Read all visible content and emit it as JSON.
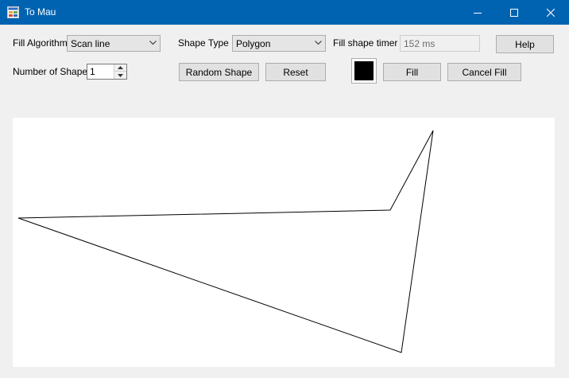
{
  "window": {
    "title": "To Mau",
    "app_icon": "form-icon",
    "titlebar_color": "#0063b1",
    "controls": [
      "minimize-icon",
      "maximize-icon",
      "close-icon"
    ]
  },
  "toolbar": {
    "fill_algorithm_label": "Fill Algorithm",
    "fill_algorithm_value": "Scan line",
    "shape_type_label": "Shape Type",
    "shape_type_value": "Polygon",
    "fill_timer_label": "Fill shape timer",
    "fill_timer_value": "152 ms",
    "help_label": "Help",
    "number_of_shape_label": "Number of Shape",
    "number_of_shape_value": "1",
    "random_shape_label": "Random Shape",
    "reset_label": "Reset",
    "fill_color": "#000000",
    "fill_label": "Fill",
    "cancel_fill_label": "Cancel Fill"
  },
  "canvas": {
    "background": "#ffffff",
    "stroke_color": "#000000",
    "shape_type": "Polygon"
  }
}
